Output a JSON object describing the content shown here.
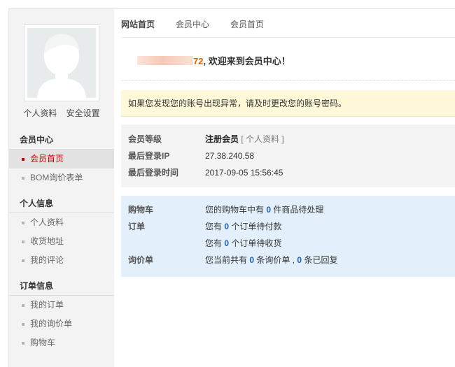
{
  "sidebar": {
    "profile_link": "个人资料",
    "security_link": "安全设置",
    "sections": [
      {
        "title": "会员中心",
        "items": [
          "会员首页",
          "BOM询价表单"
        ]
      },
      {
        "title": "个人信息",
        "items": [
          "个人资料",
          "收货地址",
          "我的评论"
        ]
      },
      {
        "title": "订单信息",
        "items": [
          "我的订单",
          "我的询价单",
          "购物车"
        ]
      }
    ]
  },
  "topnav": [
    "网站首页",
    "会员中心",
    "会员首页"
  ],
  "welcome": {
    "num": "72",
    "text": ", 欢迎来到会员中心！"
  },
  "notice": "如果您发现您的账号出现异常，请及时更改您的账号密码。",
  "level": {
    "level_label": "会员等级",
    "level_value": "注册会员",
    "profile_open": "[",
    "profile_link": "个人资料",
    "profile_close": "]",
    "ip_label": "最后登录IP",
    "ip_value": "27.38.240.58",
    "time_label": "最后登录时间",
    "time_value": "2017-09-05 15:56:45"
  },
  "info": {
    "cart_label": "购物车",
    "cart_pre": "您的购物车中有",
    "cart_count": "0",
    "cart_post": "件商品待处理",
    "order_label": "订单",
    "pay_pre": "您有",
    "pay_count": "0",
    "pay_post": "个订单待付款",
    "recv_pre": "您有",
    "recv_count": "0",
    "recv_post": "个订单待收货",
    "inquiry_label": "询价单",
    "inq_pre": "您当前共有",
    "inq_count": "0",
    "inq_mid": "条询价单 ,",
    "inq_reply": "0",
    "inq_post": "条已回复"
  },
  "colors": {
    "accent": "#cc0000",
    "link_blue": "#1a5fb4",
    "orange": "#e05a00",
    "notice_bg": "#fff8d9",
    "info_bg": "#e3f0fb"
  }
}
